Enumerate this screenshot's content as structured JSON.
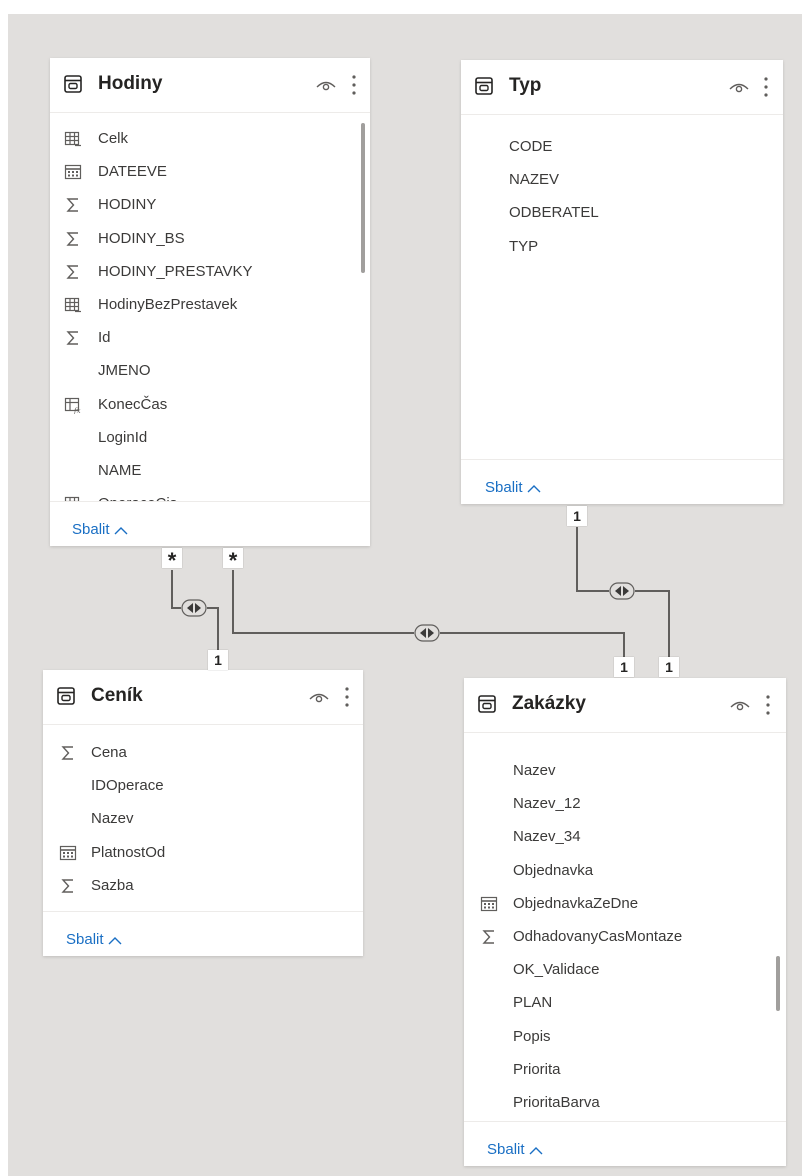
{
  "tables": {
    "hodiny": {
      "title": "Hodiny",
      "collapse": "Sbalit",
      "fields": [
        {
          "icon": "calculated-table-icon",
          "label": "Celk"
        },
        {
          "icon": "calendar-icon",
          "label": "DATEEVE"
        },
        {
          "icon": "sigma-icon",
          "label": "HODINY"
        },
        {
          "icon": "sigma-icon",
          "label": "HODINY_BS"
        },
        {
          "icon": "sigma-icon",
          "label": "HODINY_PRESTAVKY"
        },
        {
          "icon": "calculated-table-icon",
          "label": "HodinyBezPrestavek"
        },
        {
          "icon": "sigma-icon",
          "label": "Id"
        },
        {
          "icon": "none",
          "label": "JMENO"
        },
        {
          "icon": "calculated-fx-icon",
          "label": "KonecČas"
        },
        {
          "icon": "none",
          "label": "LoginId"
        },
        {
          "icon": "none",
          "label": "NAME"
        },
        {
          "icon": "calculated-table-icon",
          "label": "OperaceCis"
        }
      ]
    },
    "typ": {
      "title": "Typ",
      "collapse": "Sbalit",
      "fields": [
        {
          "icon": "none",
          "label": "CODE"
        },
        {
          "icon": "none",
          "label": "NAZEV"
        },
        {
          "icon": "none",
          "label": "ODBERATEL"
        },
        {
          "icon": "none",
          "label": "TYP"
        }
      ]
    },
    "cenik": {
      "title": "Ceník",
      "collapse": "Sbalit",
      "fields": [
        {
          "icon": "sigma-icon",
          "label": "Cena"
        },
        {
          "icon": "none",
          "label": "IDOperace"
        },
        {
          "icon": "none",
          "label": "Nazev"
        },
        {
          "icon": "calendar-icon",
          "label": "PlatnostOd"
        },
        {
          "icon": "sigma-icon",
          "label": "Sazba"
        }
      ]
    },
    "zakazky": {
      "title": "Zakázky",
      "collapse": "Sbalit",
      "fields": [
        {
          "icon": "none",
          "label": "Nazev"
        },
        {
          "icon": "none",
          "label": "Nazev_12"
        },
        {
          "icon": "none",
          "label": "Nazev_34"
        },
        {
          "icon": "none",
          "label": "Objednavka"
        },
        {
          "icon": "calendar-icon",
          "label": "ObjednavkaZeDne"
        },
        {
          "icon": "sigma-icon",
          "label": "OdhadovanyCasMontaze"
        },
        {
          "icon": "none",
          "label": "OK_Validace"
        },
        {
          "icon": "none",
          "label": "PLAN"
        },
        {
          "icon": "none",
          "label": "Popis"
        },
        {
          "icon": "none",
          "label": "Priorita"
        },
        {
          "icon": "none",
          "label": "PrioritaBarva"
        }
      ]
    }
  },
  "relationships": {
    "hodiny_cenik": {
      "many": "*",
      "one": "1"
    },
    "hodiny_zakazky": {
      "many": "*",
      "one": "1"
    },
    "typ_zakazky": {
      "one_a": "1",
      "one_b": "1"
    }
  },
  "colors": {
    "canvas": "#e1dfdd",
    "link": "#1a6fc4",
    "line": "#605e5c"
  }
}
